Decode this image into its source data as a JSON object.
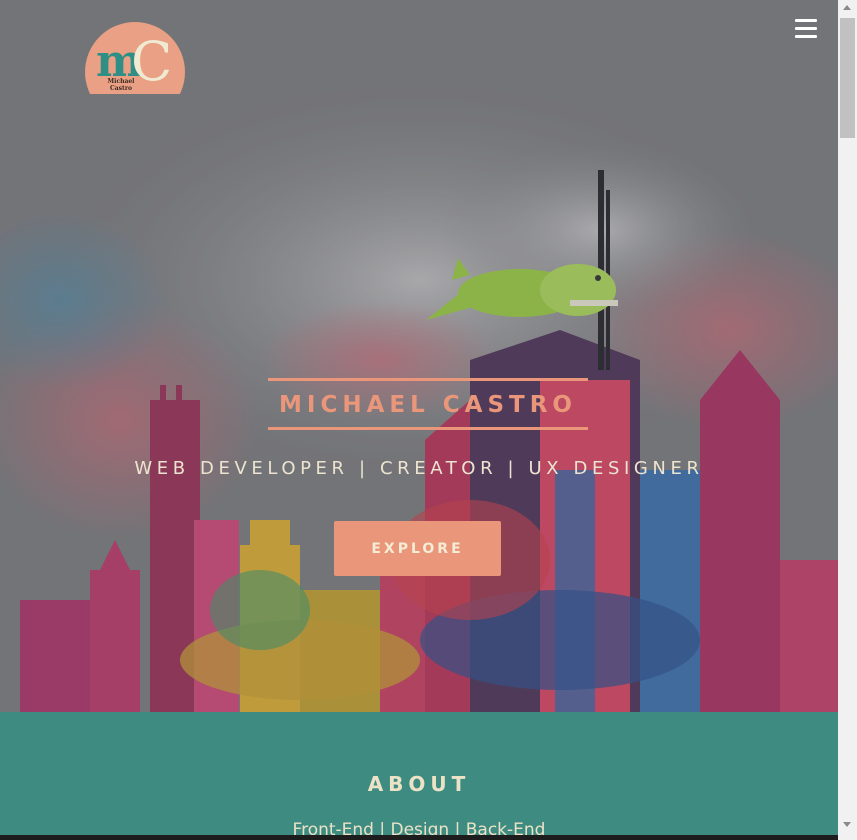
{
  "logo": {
    "letter_m": "m",
    "letter_c": "C",
    "caption": "Michael Castro"
  },
  "nav": {
    "menu_icon": "hamburger-menu-icon"
  },
  "hero": {
    "title": "MICHAEL CASTRO",
    "tagline": "WEB DEVELOPER | CREATOR | UX DESIGNER",
    "explore_label": "EXPLORE",
    "illustration": "dinosaur-on-skyline"
  },
  "about": {
    "heading": "ABOUT",
    "skills": "Front-End | Design | Back-End"
  },
  "colors": {
    "accent": "#e9967a",
    "about_bg": "#3e8b82",
    "cream_text": "#ece3c6"
  }
}
